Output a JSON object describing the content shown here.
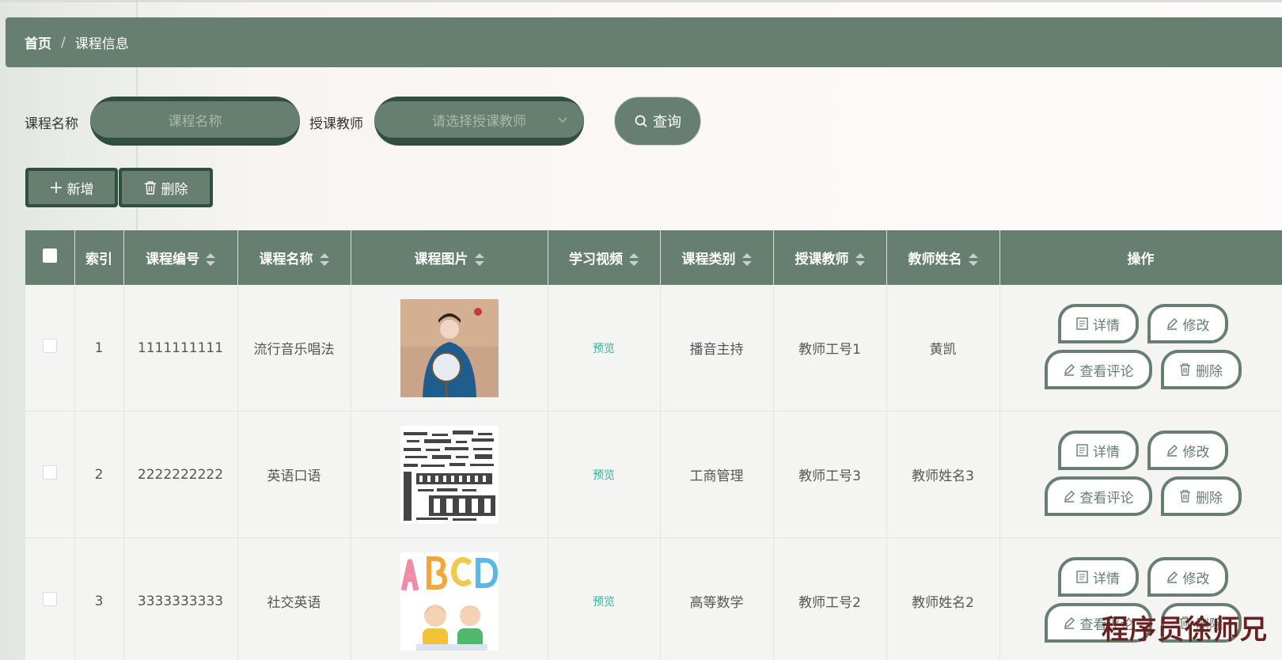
{
  "breadcrumb": {
    "home": "首页",
    "separator": "/",
    "current": "课程信息"
  },
  "search": {
    "course_name_label": "课程名称",
    "course_name_placeholder": "课程名称",
    "teacher_label": "授课教师",
    "teacher_placeholder": "请选择授课教师",
    "query_label": "查询"
  },
  "actions": {
    "add_label": "新增",
    "delete_label": "删除"
  },
  "table": {
    "headers": [
      "索引",
      "课程编号",
      "课程名称",
      "课程图片",
      "学习视频",
      "课程类别",
      "授课教师",
      "教师姓名",
      "操作"
    ],
    "rows": [
      {
        "index": "1",
        "code": "1111111111",
        "name": "流行音乐唱法",
        "image": "portrait-photo",
        "video": "预览",
        "category": "播音主持",
        "teacher": "教师工号1",
        "teacher_name": "黄凯"
      },
      {
        "index": "2",
        "code": "2222222222",
        "name": "英语口语",
        "image": "word-cloud",
        "video": "预览",
        "category": "工商管理",
        "teacher": "教师工号3",
        "teacher_name": "教师姓名3"
      },
      {
        "index": "3",
        "code": "3333333333",
        "name": "社交英语",
        "image": "abcd-kids",
        "video": "预览",
        "category": "高等数学",
        "teacher": "教师工号2",
        "teacher_name": "教师姓名2"
      }
    ],
    "row_ops": {
      "detail": "详情",
      "edit": "修改",
      "comments": "查看评论",
      "delete": "删除"
    }
  },
  "watermark": "程序员徐师兄",
  "colors": {
    "primary": "#667f70",
    "dark": "#304f3f",
    "preview_link": "#3cb39a"
  }
}
